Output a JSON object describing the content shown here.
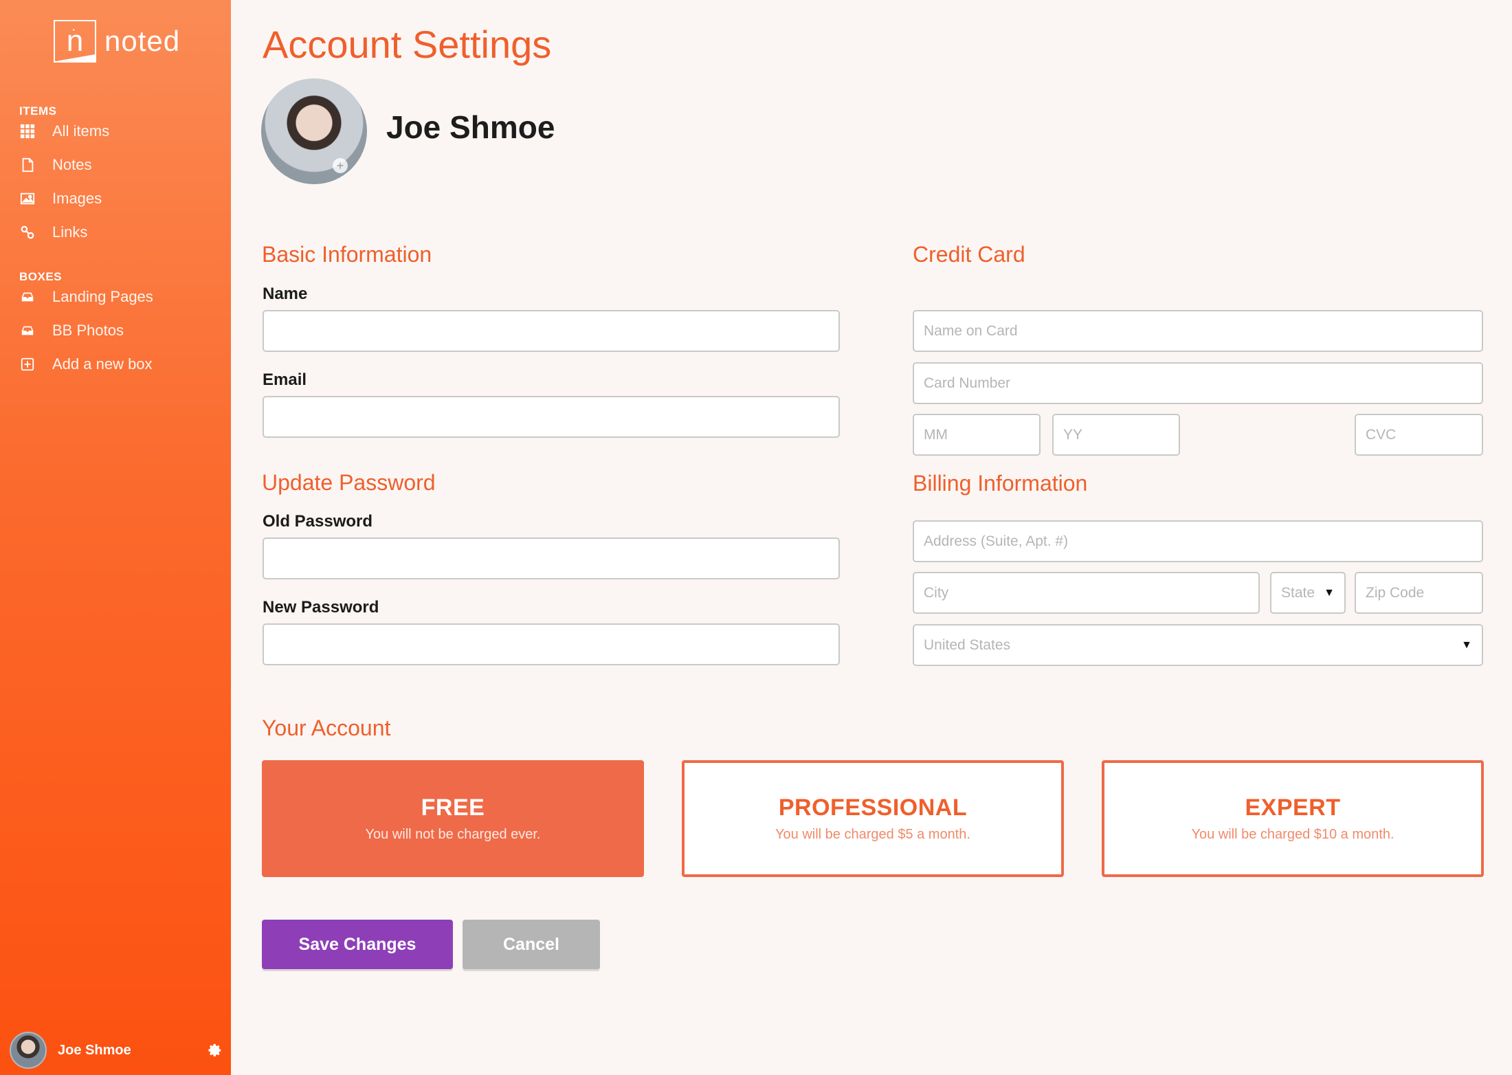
{
  "colors": {
    "accent": "#ef5f2c",
    "sidebar_gradient_top": "#fb8b55",
    "sidebar_gradient_bottom": "#fc5110",
    "save_button": "#8e3fb8",
    "cancel_button": "#b5b5b5",
    "plan_selected": "#ef6a48"
  },
  "sidebar": {
    "logo_text": "noted",
    "logo_letter": "n",
    "sections": [
      {
        "title": "ITEMS",
        "items": [
          {
            "label": "All items",
            "icon": "grid-icon"
          },
          {
            "label": "Notes",
            "icon": "document-icon"
          },
          {
            "label": "Images",
            "icon": "image-icon"
          },
          {
            "label": "Links",
            "icon": "link-icon"
          }
        ]
      },
      {
        "title": "BOXES",
        "items": [
          {
            "label": "Landing Pages",
            "icon": "inbox-icon"
          },
          {
            "label": "BB Photos",
            "icon": "inbox-icon"
          },
          {
            "label": "Add a new box",
            "icon": "plus-square-icon"
          }
        ]
      }
    ],
    "user": {
      "name": "Joe Shmoe",
      "settings_icon": "gear-icon"
    }
  },
  "main": {
    "title": "Account Settings",
    "profile": {
      "name": "Joe Shmoe",
      "add_photo_icon": "plus-icon"
    },
    "basic_info": {
      "title": "Basic Information",
      "name_label": "Name",
      "name_value": "",
      "email_label": "Email",
      "email_value": ""
    },
    "password": {
      "title": "Update Password",
      "old_label": "Old Password",
      "new_label": "New Password"
    },
    "credit_card": {
      "title": "Credit Card",
      "name_placeholder": "Name on Card",
      "number_placeholder": "Card Number",
      "mm_placeholder": "MM",
      "yy_placeholder": "YY",
      "cvc_placeholder": "CVC"
    },
    "billing": {
      "title": "Billing Information",
      "address_placeholder": "Address (Suite, Apt. #)",
      "city_placeholder": "City",
      "state_value": "State",
      "zip_placeholder": "Zip Code",
      "country_value": "United States"
    },
    "account": {
      "title": "Your Account",
      "plans": [
        {
          "name": "FREE",
          "desc": "You will not be charged ever.",
          "selected": true
        },
        {
          "name": "PROFESSIONAL",
          "desc": "You will be charged $5 a month.",
          "selected": false
        },
        {
          "name": "EXPERT",
          "desc": "You will be charged $10 a month.",
          "selected": false
        }
      ]
    },
    "buttons": {
      "save": "Save Changes",
      "cancel": "Cancel"
    }
  }
}
